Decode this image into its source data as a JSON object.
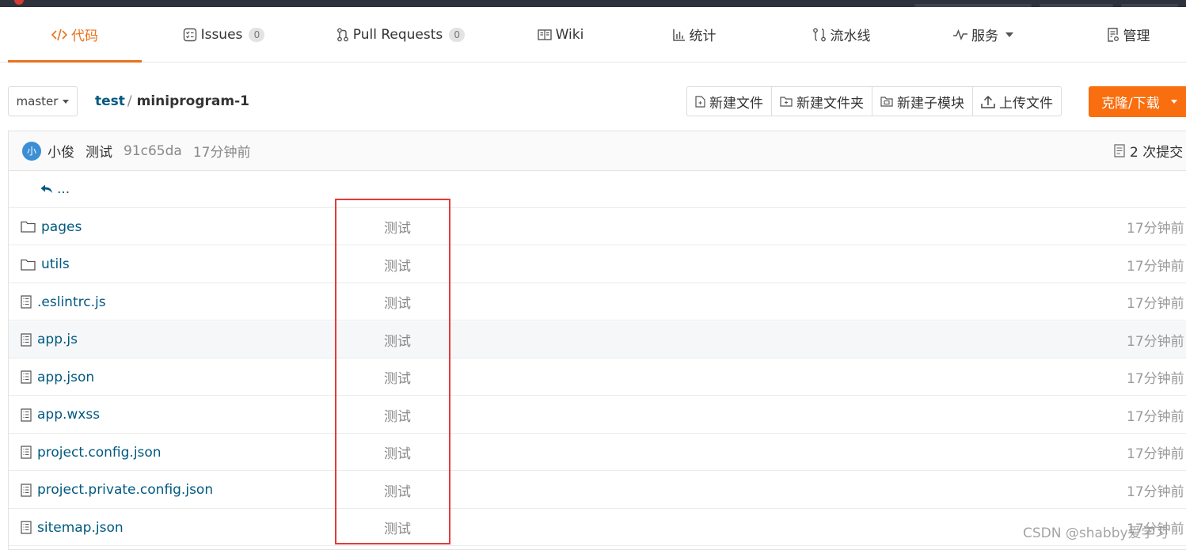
{
  "tabs": [
    {
      "label": "代码",
      "icon": "code-icon"
    },
    {
      "label": "Issues",
      "icon": "issues-icon",
      "badge": "0"
    },
    {
      "label": "Pull Requests",
      "icon": "pull-request-icon",
      "badge": "0"
    },
    {
      "label": "Wiki",
      "icon": "book-icon"
    },
    {
      "label": "统计",
      "icon": "bar-chart-icon"
    },
    {
      "label": "流水线",
      "icon": "pipeline-icon"
    },
    {
      "label": "服务",
      "icon": "pulse-icon"
    },
    {
      "label": "管理",
      "icon": "settings-doc-icon"
    }
  ],
  "repo": {
    "branch": "master",
    "owner": "test",
    "name": "miniprogram-1"
  },
  "actions": {
    "new_file": "新建文件",
    "new_folder": "新建文件夹",
    "new_submodule": "新建子模块",
    "upload": "上传文件",
    "clone": "克隆/下载"
  },
  "commit": {
    "avatar_initial": "小",
    "author": "小俊",
    "message": "测试",
    "sha": "91c65da",
    "time": "17分钟前",
    "count": "2 次提交"
  },
  "back_link": "...",
  "files": [
    {
      "name": "pages",
      "type": "folder",
      "message": "测试",
      "time": "17分钟前"
    },
    {
      "name": "utils",
      "type": "folder",
      "message": "测试",
      "time": "17分钟前"
    },
    {
      "name": ".eslintrc.js",
      "type": "file",
      "message": "测试",
      "time": "17分钟前"
    },
    {
      "name": "app.js",
      "type": "file",
      "message": "测试",
      "time": "17分钟前"
    },
    {
      "name": "app.json",
      "type": "file",
      "message": "测试",
      "time": "17分钟前"
    },
    {
      "name": "app.wxss",
      "type": "file",
      "message": "测试",
      "time": "17分钟前"
    },
    {
      "name": "project.config.json",
      "type": "file",
      "message": "测试",
      "time": "17分钟前"
    },
    {
      "name": "project.private.config.json",
      "type": "file",
      "message": "测试",
      "time": "17分钟前"
    },
    {
      "name": "sitemap.json",
      "type": "file",
      "message": "测试",
      "time": "17分钟前"
    }
  ],
  "watermark": "CSDN @shabby爱学习",
  "colors": {
    "accent": "#e8721b",
    "clone_button": "#f96e0e",
    "link": "#005980",
    "highlight_box": "#e53a3a"
  }
}
